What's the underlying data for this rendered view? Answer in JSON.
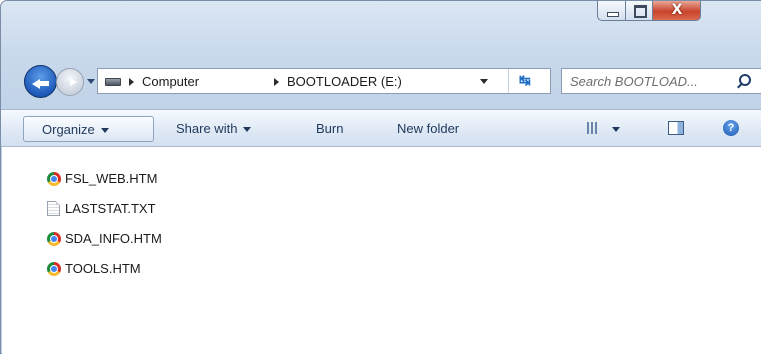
{
  "window": {
    "caption": {
      "minimize": "minimize",
      "maximize": "maximize",
      "close_glyph": "X"
    }
  },
  "nav": {
    "breadcrumb": [
      "Computer",
      "BOOTLOADER (E:)"
    ],
    "search_placeholder": "Search BOOTLOAD..."
  },
  "toolbar": {
    "organize": "Organize",
    "share_with": "Share with",
    "burn": "Burn",
    "new_folder": "New folder",
    "help_glyph": "?"
  },
  "files": [
    {
      "name": "FSL_WEB.HTM",
      "icon": "chrome-icon"
    },
    {
      "name": "LASTSTAT.TXT",
      "icon": "text-file-icon"
    },
    {
      "name": "SDA_INFO.HTM",
      "icon": "chrome-icon"
    },
    {
      "name": "TOOLS.HTM",
      "icon": "chrome-icon"
    }
  ]
}
